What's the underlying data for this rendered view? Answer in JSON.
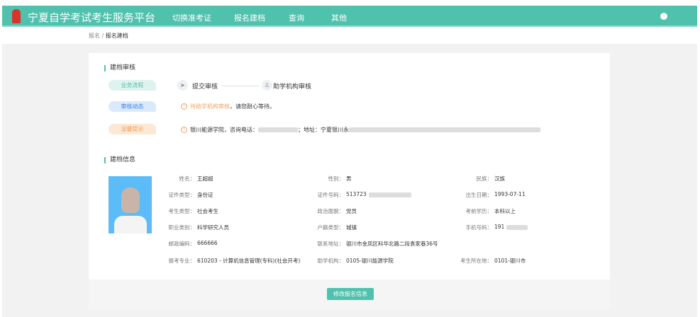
{
  "header": {
    "title": "宁夏自学考试考生服务平台",
    "nav": [
      "切换准考证",
      "报名建档",
      "查询",
      "其他"
    ]
  },
  "breadcrumb": {
    "root": "报名",
    "sep": "/",
    "current": "报名建档"
  },
  "review": {
    "title": "建档审核",
    "process_label": "业务流程",
    "steps": [
      "提交审核",
      "助学机构审核"
    ],
    "status_label": "审核动态",
    "status_highlight": "待助学机构审核",
    "status_rest": "，请您耐心等待。",
    "tip_label": "温馨提示",
    "tip_text": "银川能源学院，咨询电话：",
    "tip_addr": "；地址：宁夏银川永"
  },
  "info": {
    "title": "建档信息",
    "fields": [
      {
        "label": "姓名：",
        "value": "王超超"
      },
      {
        "label": "性别：",
        "value": "男"
      },
      {
        "label": "民族：",
        "value": "汉族"
      },
      {
        "label": "证件类型：",
        "value": "身份证"
      },
      {
        "label": "证件号码：",
        "value": "513723"
      },
      {
        "label": "出生日期：",
        "value": "1993-07-11"
      },
      {
        "label": "考生类型：",
        "value": "社会考生"
      },
      {
        "label": "政治面貌：",
        "value": "党员"
      },
      {
        "label": "考前学历：",
        "value": "本科以上"
      },
      {
        "label": "职业类别：",
        "value": "科学研究人员"
      },
      {
        "label": "户籍类型：",
        "value": "城镇"
      },
      {
        "label": "手机号码：",
        "value": "191"
      },
      {
        "label": "邮政编码：",
        "value": "666666"
      },
      {
        "label": "联系地址：",
        "value": "银川市金凤区科华北路二段袁家巷36号"
      },
      {
        "label": "",
        "value": ""
      },
      {
        "label": "报考专业：",
        "value": "610203 - 计算机信息管理(专科)(社会开考)"
      },
      {
        "label": "助学机构：",
        "value": "0105-银川能源学院"
      },
      {
        "label": "考生所在地：",
        "value": "0101-银川市"
      }
    ]
  },
  "footer": {
    "edit_button": "修改报名信息"
  }
}
